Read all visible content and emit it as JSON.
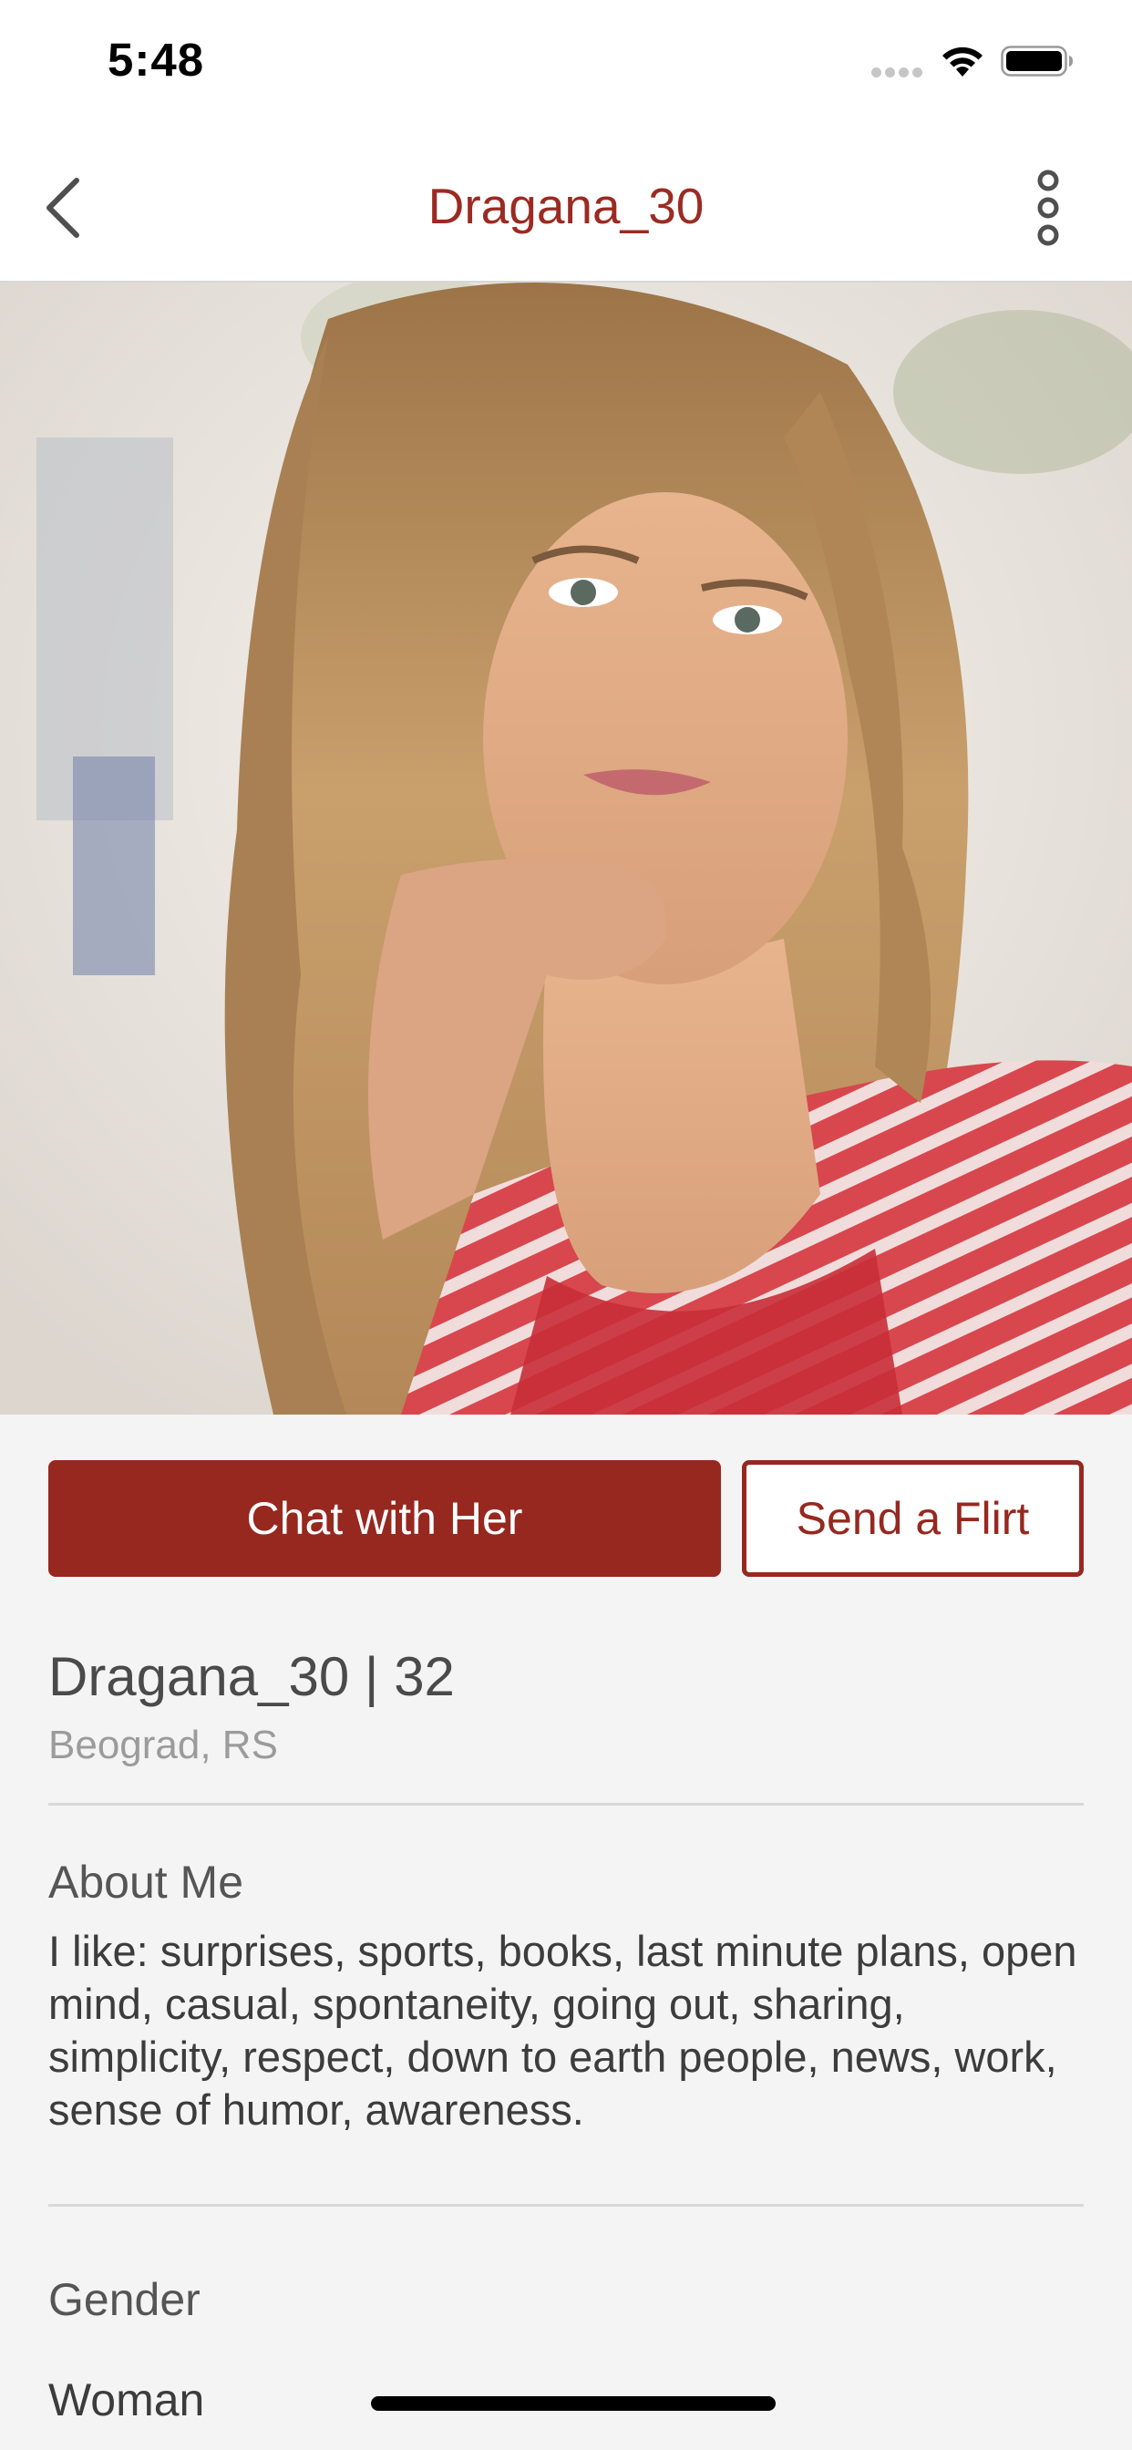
{
  "status_bar": {
    "time": "5:48"
  },
  "nav": {
    "title": "Dragana_30",
    "back_icon": "chevron-left-icon",
    "more_icon": "vertical-ellipsis-icon"
  },
  "actions": {
    "chat_label": "Chat with Her",
    "flirt_label": "Send a Flirt"
  },
  "profile": {
    "heading": "Dragana_30 | 32",
    "location": "Beograd, RS"
  },
  "about": {
    "label": "About Me",
    "text": "I like: surprises, sports, books, last minute plans, open mind, casual, spontaneity, going out, sharing, simplicity, respect, down to earth people, news, work, sense of humor, awareness."
  },
  "gender": {
    "label": "Gender",
    "value": "Woman"
  },
  "colors": {
    "accent": "#97281f",
    "title": "#9b2b22",
    "background": "#f4f4f4"
  }
}
